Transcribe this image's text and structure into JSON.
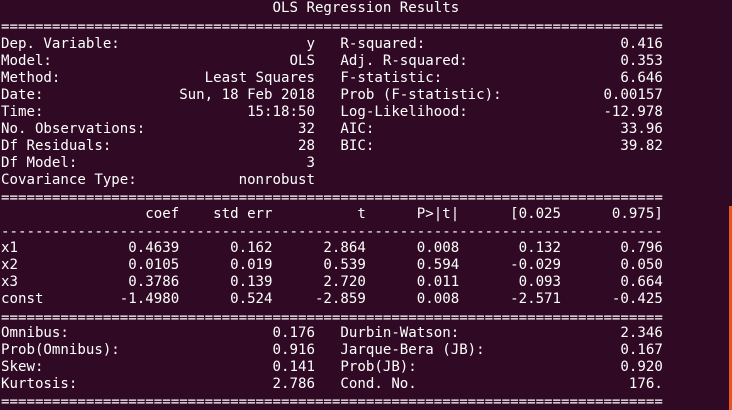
{
  "terminal": {
    "lines": [
      "                                OLS Regression Results                            ",
      "==============================================================================",
      "Dep. Variable:                      y   R-squared:                       0.416",
      "Model:                            OLS   Adj. R-squared:                  0.353",
      "Method:                 Least Squares   F-statistic:                     6.646",
      "Date:                Sun, 18 Feb 2018   Prob (F-statistic):            0.00157",
      "Time:                        15:18:50   Log-Likelihood:                -12.978",
      "No. Observations:                  32   AIC:                             33.96",
      "Df Residuals:                      28   BIC:                             39.82",
      "Df Model:                           3                                         ",
      "Covariance Type:            nonrobust                                         ",
      "==============================================================================",
      "                 coef    std err          t      P>|t|      [0.025      0.975]",
      "------------------------------------------------------------------------------",
      "x1             0.4639      0.162      2.864      0.008       0.132       0.796",
      "x2             0.0105      0.019      0.539      0.594      -0.029       0.050",
      "x3             0.3786      0.139      2.720      0.011       0.093       0.664",
      "const         -1.4980      0.524     -2.859      0.008      -2.571      -0.425",
      "==============================================================================",
      "Omnibus:                        0.176   Durbin-Watson:                   2.346",
      "Prob(Omnibus):                  0.916   Jarque-Bera (JB):                0.167",
      "Skew:                           0.141   Prob(JB):                        0.920",
      "Kurtosis:                       2.786   Cond. No.                         176.",
      "=============================================================================="
    ]
  }
}
